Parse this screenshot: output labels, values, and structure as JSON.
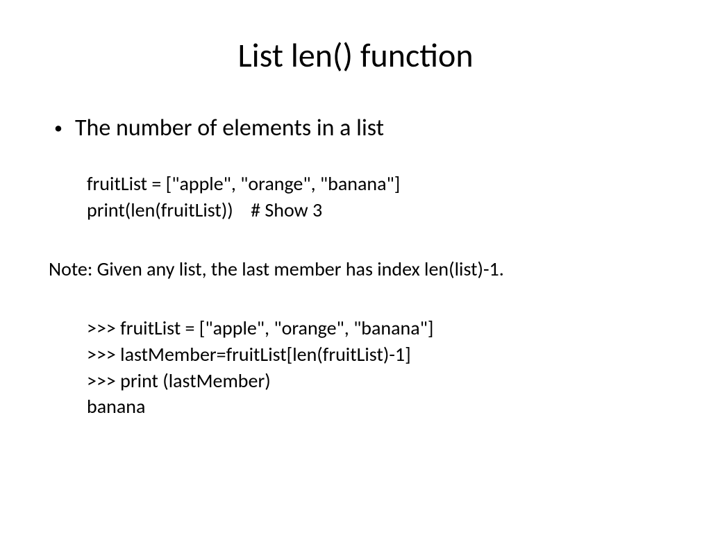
{
  "title": "List len() function",
  "bullet": "The number of elements in a list",
  "code1": {
    "line1": "fruitList = [\"apple\", \"orange\", \"banana\"]",
    "line2": "print(len(fruitList))    # Show 3"
  },
  "note": "Note: Given any list, the last member has index len(list)-1.",
  "code2": {
    "line1": ">>> fruitList = [\"apple\", \"orange\", \"banana\"]",
    "line2": ">>> lastMember=fruitList[len(fruitList)-1]",
    "line3": ">>> print (lastMember)",
    "line4": "banana"
  }
}
